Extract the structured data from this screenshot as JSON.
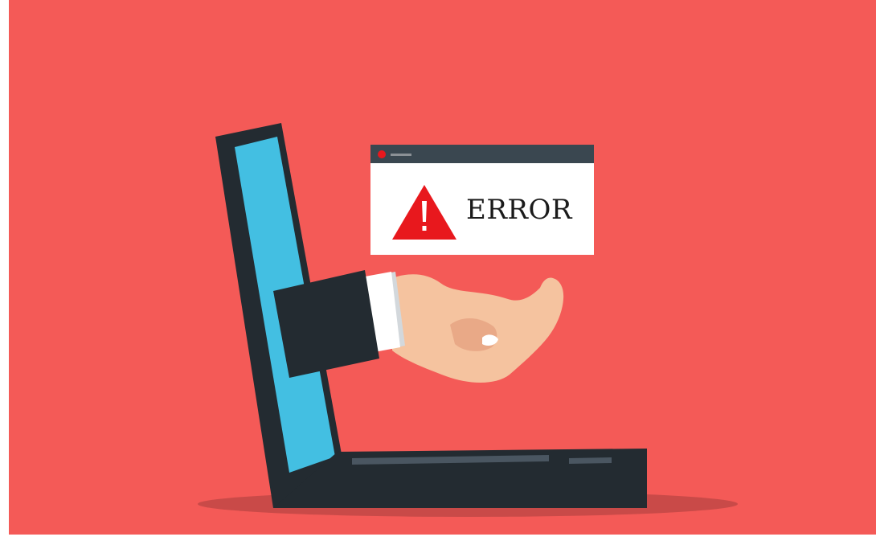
{
  "scene": {
    "description_free": true,
    "background_color": "#f45a57",
    "frame_color": "#ffffff",
    "shadow_color": "#c94a48"
  },
  "laptop": {
    "body_color": "#232b31",
    "screen_color": "#43bfe2",
    "keyboard_strip_color": "#4a5661"
  },
  "error_window": {
    "titlebar_color": "#3a4750",
    "close_dot_color": "#e8181d",
    "title_line_color": "#8b9196",
    "body_color": "#ffffff",
    "label": "ERROR",
    "warning_icon": "warning-triangle-icon",
    "warning_color": "#e8181d",
    "text_color": "#1b1b1b"
  },
  "arm": {
    "sleeve_color": "#232b31",
    "cuff_color": "#ffffff",
    "cuff_shadow_color": "#d3d8dc",
    "skin_color": "#f5c39f",
    "skin_shadow_color": "#e9a987",
    "knuckle_color": "#ffffff"
  }
}
